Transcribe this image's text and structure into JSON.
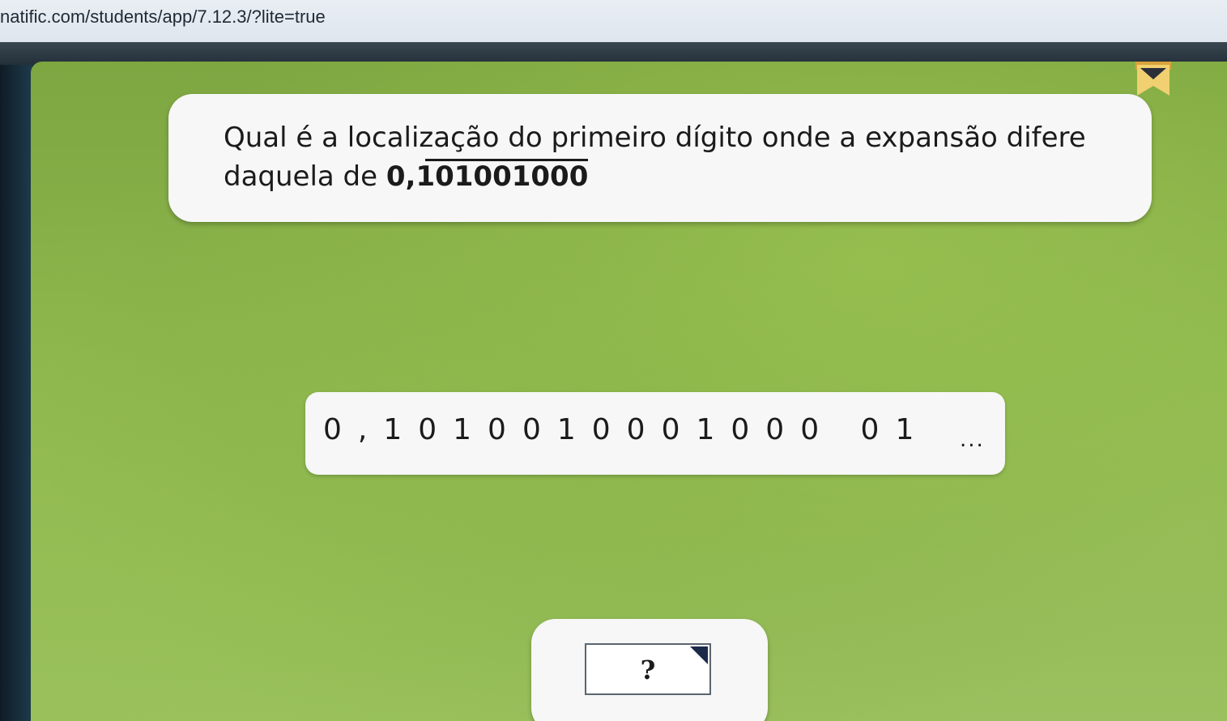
{
  "browser": {
    "url": "natific.com/students/app/7.12.3/?lite=true"
  },
  "question": {
    "text": "Qual é a localização do primeiro dígito onde a expansão difere daquela de ",
    "number": "0,101001000"
  },
  "expansion": {
    "digits": "0,1010010001000 01",
    "ellipsis": "..."
  },
  "answer": {
    "value": "?"
  },
  "colors": {
    "card": "#f6f7f6",
    "background_green": "#8db64d",
    "bookmark": "#2b2f38"
  },
  "icons": {
    "bookmark": "bookmark-icon",
    "dropdown": "dropdown-triangle-icon"
  }
}
